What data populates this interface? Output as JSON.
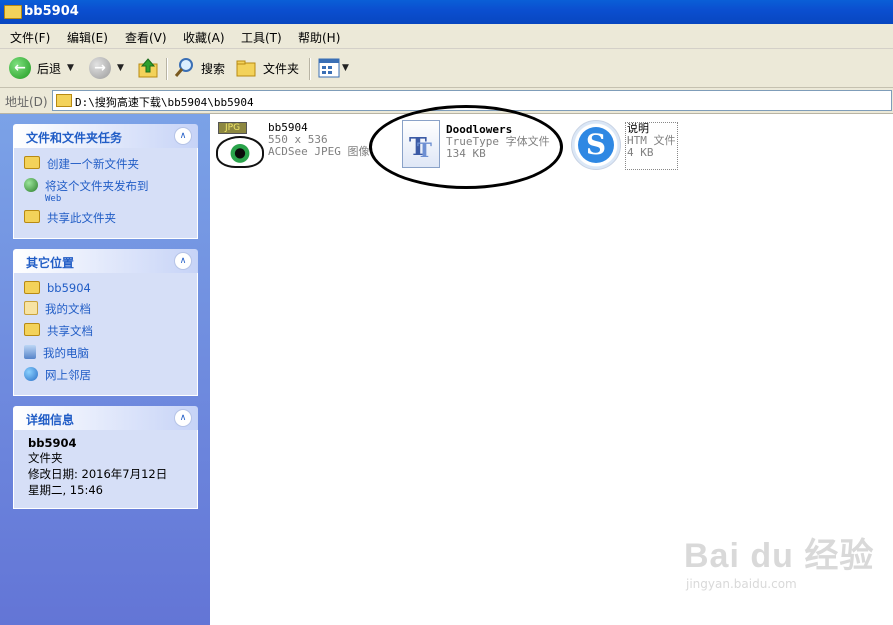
{
  "window": {
    "title": "bb5904"
  },
  "menu": [
    "文件(F)",
    "编辑(E)",
    "查看(V)",
    "收藏(A)",
    "工具(T)",
    "帮助(H)"
  ],
  "toolbar": {
    "back": "后退",
    "search": "搜索",
    "folders": "文件夹"
  },
  "address": {
    "label": "地址(D)",
    "path": "D:\\搜狗高速下载\\bb5904\\bb5904"
  },
  "tasks": {
    "title": "文件和文件夹任务",
    "items": [
      {
        "label": "创建一个新文件夹",
        "icon": "new-folder-icon"
      },
      {
        "label": "将这个文件夹发布到",
        "sub": "Web",
        "icon": "publish-web-icon"
      },
      {
        "label": "共享此文件夹",
        "icon": "share-folder-icon"
      }
    ]
  },
  "places": {
    "title": "其它位置",
    "items": [
      {
        "label": "bb5904",
        "icon": "folder-icon"
      },
      {
        "label": "我的文档",
        "icon": "my-documents-icon"
      },
      {
        "label": "共享文档",
        "icon": "shared-documents-icon"
      },
      {
        "label": "我的电脑",
        "icon": "my-computer-icon"
      },
      {
        "label": "网上邻居",
        "icon": "network-icon"
      }
    ]
  },
  "details": {
    "title": "详细信息",
    "name": "bb5904",
    "type": "文件夹",
    "modified": "修改日期: 2016年7月12日",
    "time": "星期二, 15:46"
  },
  "files": [
    {
      "name": "bb5904",
      "line2": "550 x 536",
      "line3": "ACDSee JPEG 图像",
      "icon": "jpeg-file-icon",
      "badge": "JPG"
    },
    {
      "name": "Doodlowers",
      "line2": "TrueType 字体文件",
      "line3": "134 KB",
      "icon": "truetype-font-icon"
    },
    {
      "name": "说明",
      "line2": "HTM 文件",
      "line3": "4 KB",
      "icon": "sogou-browser-icon"
    }
  ],
  "watermark": {
    "brand": "Bai du 经验",
    "url": "jingyan.baidu.com"
  }
}
